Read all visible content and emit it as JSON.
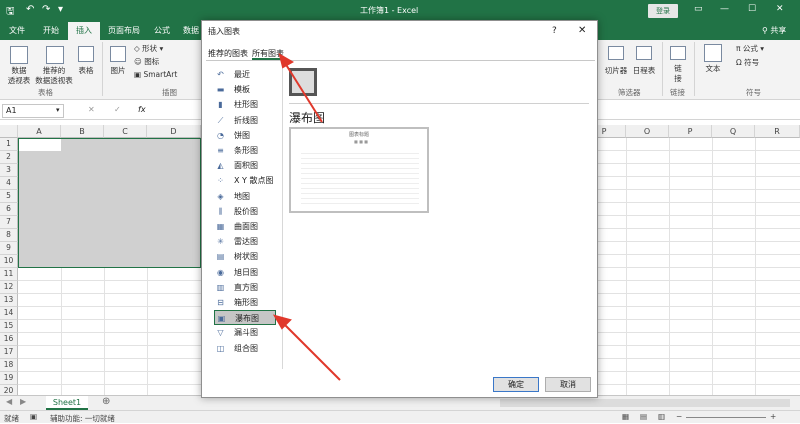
{
  "titlebar": {
    "doc_title": "工作簿1  -  Excel",
    "login": "登录",
    "save_icon": "save-icon",
    "undo_icon": "undo-icon"
  },
  "tabs": [
    "文件",
    "开始",
    "插入",
    "页面布局",
    "公式",
    "数据"
  ],
  "active_tab": "插入",
  "share": "共享",
  "ribbon": {
    "pivot": "数据\n透视表",
    "recommended_pivot": "推荐的\n数据透视表",
    "table": "表格",
    "picture": "图片",
    "shapes": "形状",
    "icons": "图标",
    "smartart": "SmartArt",
    "group_table": "表格",
    "group_illustrations": "插图",
    "slicer": "切片器",
    "timeline": "日程表",
    "group_filter": "筛选器",
    "link": "链\n接",
    "group_links": "链接",
    "text": "文本",
    "equation": "公式",
    "symbol": "符号",
    "group_symbols": "符号"
  },
  "formula_bar": {
    "name_box": "A1",
    "fx": "fx"
  },
  "columns": [
    "A",
    "B",
    "C",
    "D",
    "P",
    "O",
    "P",
    "Q",
    "R"
  ],
  "rows": [
    "1",
    "2",
    "3",
    "4",
    "5",
    "6",
    "7",
    "8",
    "9",
    "10",
    "11",
    "12",
    "13",
    "14",
    "15",
    "16",
    "17",
    "18",
    "19",
    "20"
  ],
  "sheet_tab": "Sheet1",
  "status": {
    "ready": "就绪",
    "accessibility": "辅助功能: 一切就绪"
  },
  "dialog": {
    "title": "插入图表",
    "help": "?",
    "tabs": {
      "recommended": "推荐的图表",
      "all": "所有图表"
    },
    "categories": [
      {
        "label": "最近",
        "icon": "recent-icon"
      },
      {
        "label": "模板",
        "icon": "folder-icon"
      },
      {
        "label": "柱形图",
        "icon": "column-chart-icon"
      },
      {
        "label": "折线图",
        "icon": "line-chart-icon"
      },
      {
        "label": "饼图",
        "icon": "pie-chart-icon"
      },
      {
        "label": "条形图",
        "icon": "bar-chart-icon"
      },
      {
        "label": "面积图",
        "icon": "area-chart-icon"
      },
      {
        "label": "X Y 散点图",
        "icon": "scatter-chart-icon"
      },
      {
        "label": "地图",
        "icon": "map-chart-icon"
      },
      {
        "label": "股价图",
        "icon": "stock-chart-icon"
      },
      {
        "label": "曲面图",
        "icon": "surface-chart-icon"
      },
      {
        "label": "雷达图",
        "icon": "radar-chart-icon"
      },
      {
        "label": "树状图",
        "icon": "treemap-chart-icon"
      },
      {
        "label": "旭日图",
        "icon": "sunburst-chart-icon"
      },
      {
        "label": "直方图",
        "icon": "histogram-chart-icon"
      },
      {
        "label": "箱形图",
        "icon": "boxplot-chart-icon"
      },
      {
        "label": "瀑布图",
        "icon": "waterfall-chart-icon"
      },
      {
        "label": "漏斗图",
        "icon": "funnel-chart-icon"
      },
      {
        "label": "组合图",
        "icon": "combo-chart-icon"
      }
    ],
    "selected_category": "瀑布图",
    "preview_title": "瀑布图",
    "thumb_title": "图表标题",
    "ok": "确定",
    "cancel": "取消"
  },
  "colors": {
    "excel_green": "#217346",
    "arrow_red": "#e0382b"
  }
}
